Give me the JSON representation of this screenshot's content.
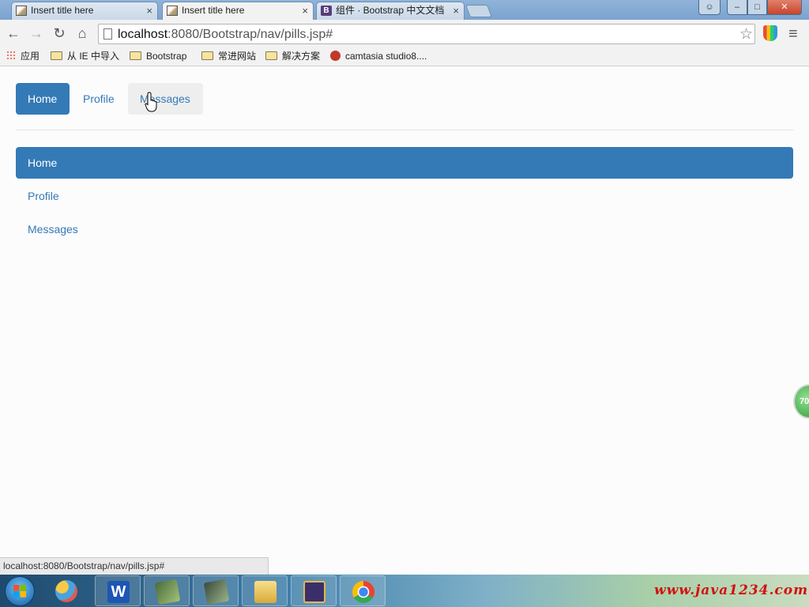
{
  "browser": {
    "tabs": [
      {
        "title": "Insert title here",
        "close": "×"
      },
      {
        "title": "Insert title here",
        "close": "×"
      },
      {
        "title": "组件 · Bootstrap 中文文档",
        "close": "×"
      }
    ],
    "window_controls": {
      "minimize": "–",
      "maximize": "□",
      "close": "✕"
    },
    "address": {
      "host": "localhost",
      "rest": ":8080/Bootstrap/nav/pills.jsp#"
    },
    "bookmarks": [
      "应用",
      "从 IE 中导入",
      "Bootstrap",
      "常进网站",
      "解决方案",
      "camtasia studio8...."
    ],
    "status_url": "localhost:8080/Bootstrap/nav/pills.jsp#"
  },
  "page": {
    "horizontal_pills": [
      {
        "label": "Home",
        "state": "active"
      },
      {
        "label": "Profile",
        "state": "normal"
      },
      {
        "label": "Messages",
        "state": "hover"
      }
    ],
    "stacked_pills": [
      {
        "label": "Home",
        "state": "active"
      },
      {
        "label": "Profile",
        "state": "normal"
      },
      {
        "label": "Messages",
        "state": "normal"
      }
    ]
  },
  "overlay": {
    "badge": "70"
  },
  "taskbar": {
    "watermark": "www.java1234.com"
  },
  "colors": {
    "primary": "#337ab7",
    "hover_bg": "#eeeeee",
    "divider": "#e5e5e5"
  }
}
